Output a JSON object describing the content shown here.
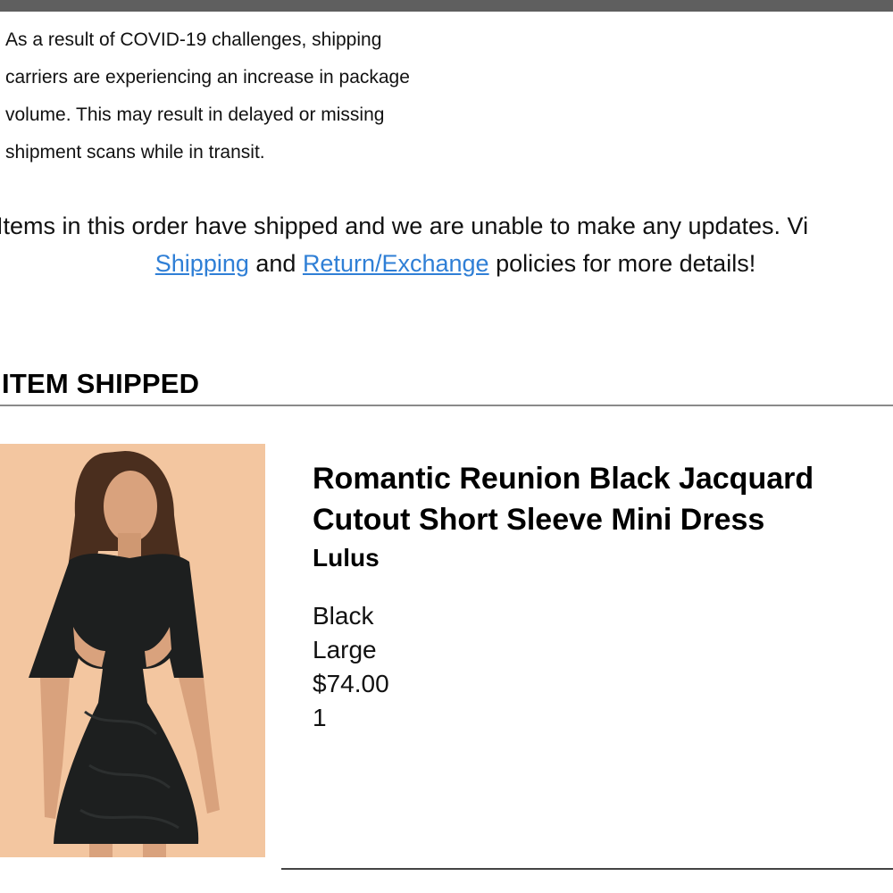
{
  "notice": {
    "lines": [
      "As a result of COVID-19 challenges, shipping",
      "carriers are experiencing an increase in package",
      "volume. This may result in delayed or missing",
      "shipment scans while in transit."
    ]
  },
  "status_message": {
    "line1": "Items in this order have shipped and we are unable to make any updates. Vi",
    "shipping_link": "Shipping",
    "and_text": " and ",
    "return_link": "Return/Exchange",
    "tail_text": " policies for more details!"
  },
  "section": {
    "title": "ITEM SHIPPED"
  },
  "item": {
    "name_line1": "Romantic Reunion Black Jacquard",
    "name_line2": "Cutout Short Sleeve Mini Dress",
    "brand": "Lulus",
    "color": "Black",
    "size": "Large",
    "price": "$74.00",
    "quantity": "1"
  },
  "colors": {
    "link": "#2f7fd6",
    "top_bar": "#5f5f5f",
    "image_background": "#f3c7a0"
  }
}
